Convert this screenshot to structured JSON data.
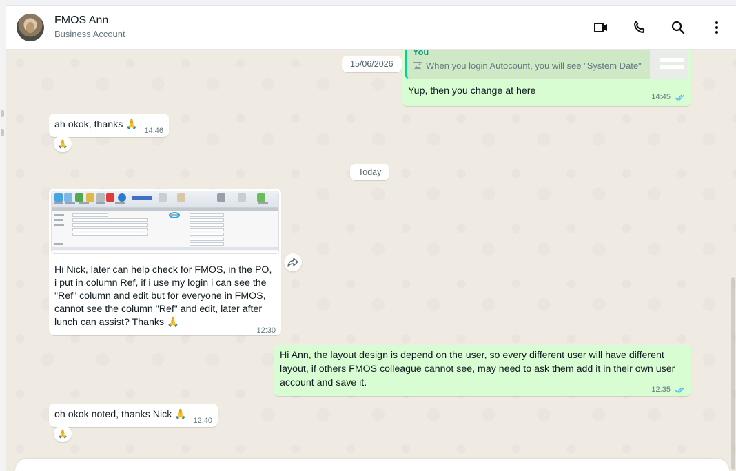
{
  "header": {
    "title": "FMOS Ann",
    "subtitle": "Business Account",
    "icons": [
      "video-call-icon",
      "voice-call-icon",
      "search-icon",
      "menu-icon"
    ]
  },
  "colors": {
    "incoming": "#ffffff",
    "outgoing": "#d9fdd3",
    "read_ticks": "#53bdeb",
    "chat_bg": "#efeae2"
  },
  "dates": {
    "first": "15/06/2026",
    "today": "Today"
  },
  "messages": {
    "m1": {
      "quote_author": "You",
      "quote_text": "When you login Autocount, you will see \"System Date\"",
      "text": "Yup, then you change at here",
      "time": "14:45"
    },
    "m2": {
      "text": "ah okok, thanks 🙏",
      "time": "14:46",
      "reaction": "🙏"
    },
    "m3": {
      "text": "Hi Nick, later can help check for FMOS, in the PO, i put in column Ref, if i use my login i can see the \"Ref\" column and edit but for everyone in FMOS, cannot see the column \"Ref\" and edit, later after lunch can assist? Thanks 🙏",
      "time": "12:30"
    },
    "m4": {
      "text": "Hi Ann, the layout design is depend on the user, so every different user will have different layout, if others FMOS colleague cannot see, may need to ask them add it in their own user account and save it.",
      "time": "12:35"
    },
    "m5": {
      "text": "oh okok noted, thanks Nick 🙏",
      "time": "12:40",
      "reaction": "🙏"
    }
  }
}
